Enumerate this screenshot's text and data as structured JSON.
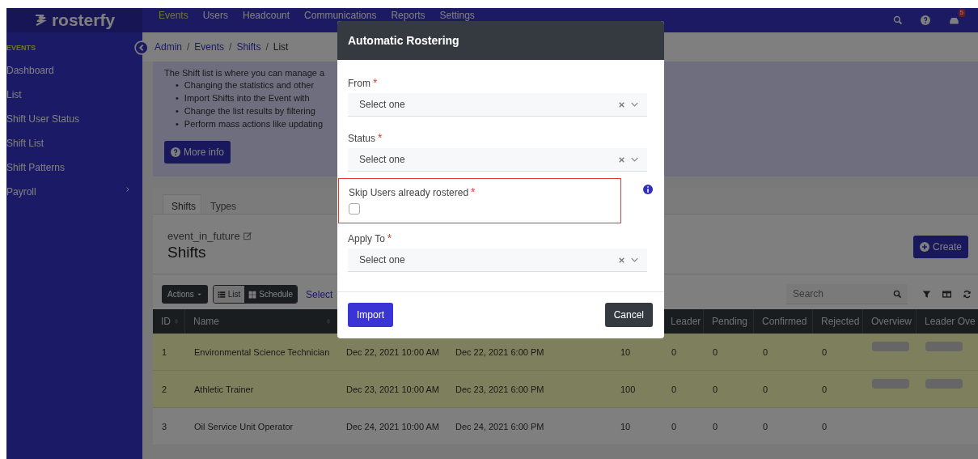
{
  "navbar": {
    "logo": "rosterfy",
    "items": [
      {
        "label": "Events",
        "selected": true
      },
      {
        "label": "Users",
        "selected": false
      },
      {
        "label": "Headcount",
        "selected": false
      },
      {
        "label": "Communications",
        "selected": false
      },
      {
        "label": "Reports",
        "selected": false
      },
      {
        "label": "Settings",
        "selected": false
      }
    ],
    "notification_badge": "5"
  },
  "sidebar": {
    "heading": "EVENTS",
    "items": [
      {
        "label": "Dashboard",
        "expandable": false
      },
      {
        "label": "List",
        "expandable": false
      },
      {
        "label": "Shift User Status",
        "expandable": false
      },
      {
        "label": "Shift List",
        "expandable": false
      },
      {
        "label": "Shift Patterns",
        "expandable": false
      },
      {
        "label": "Payroll",
        "expandable": true
      }
    ]
  },
  "breadcrumb": {
    "separator": "/",
    "items": [
      "Admin",
      "Events",
      "Shifts",
      "List"
    ]
  },
  "info_panel": {
    "intro": "The Shift list is where you can manage a",
    "marker": "•",
    "bullets": [
      "Changing the statistics and other",
      "Import Shifts into the Event with",
      "Change the list results by filtering",
      "Perform mass actions like updating"
    ],
    "button": "More info"
  },
  "tabs": [
    {
      "label": "Shifts",
      "selected": true
    },
    {
      "label": "Types",
      "selected": false
    }
  ],
  "header": {
    "event": "event_in_future",
    "title": "Shifts",
    "create_button": "Create"
  },
  "toolbar": {
    "actions": "Actions",
    "views": [
      {
        "label": "List",
        "selected": true
      },
      {
        "label": "Schedule",
        "selected": false
      }
    ],
    "link": "Select",
    "search_placeholder": "Search"
  },
  "table": {
    "columns": [
      {
        "label": "ID",
        "sortable": true
      },
      {
        "label": "Name",
        "sortable": true
      },
      {},
      {},
      {},
      {
        "label": "Leader"
      },
      {
        "label": "Pending"
      },
      {
        "label": "Confirmed"
      },
      {
        "label": "Rejected"
      },
      {
        "label": "Overview"
      },
      {
        "label": "Leader Ove"
      }
    ],
    "rows": [
      {
        "highlighted": true,
        "overview": true,
        "cells": [
          "1",
          "Environmental Science Technician",
          "Dec 22, 2021 10:00 AM",
          "Dec 22, 2021 6:00 PM",
          "10",
          "0",
          "0",
          "0",
          "0"
        ]
      },
      {
        "highlighted": true,
        "overview": true,
        "cells": [
          "2",
          "Athletic Trainer",
          "Dec 23, 2021 10:00 AM",
          "Dec 23, 2021 6:00 PM",
          "100",
          "0",
          "0",
          "0",
          "0"
        ]
      },
      {
        "highlighted": false,
        "overview": false,
        "cells": [
          "3",
          "Oil Service Unit Operator",
          "Dec 24, 2021 10:00 AM",
          "Dec 24, 2021 6:00 PM",
          "10",
          "0",
          "0",
          "0",
          "0"
        ]
      }
    ]
  },
  "modal": {
    "title": "Automatic Rostering",
    "fields": [
      {
        "kind": "select",
        "label": "From",
        "required_mark": "*",
        "placeholder": "Select one",
        "highlighted": false
      },
      {
        "kind": "select",
        "label": "Status",
        "required_mark": "*",
        "placeholder": "Select one",
        "highlighted": false
      },
      {
        "kind": "checkbox",
        "label": "Skip Users already rostered",
        "required_mark": "*",
        "checked": false,
        "highlighted": true,
        "info": true
      },
      {
        "kind": "select",
        "label": "Apply To",
        "required_mark": "*",
        "placeholder": "Select one",
        "highlighted": false
      }
    ],
    "buttons": [
      {
        "label": "Import",
        "kind": "primary"
      },
      {
        "label": "Cancel",
        "kind": "secondary"
      }
    ]
  }
}
